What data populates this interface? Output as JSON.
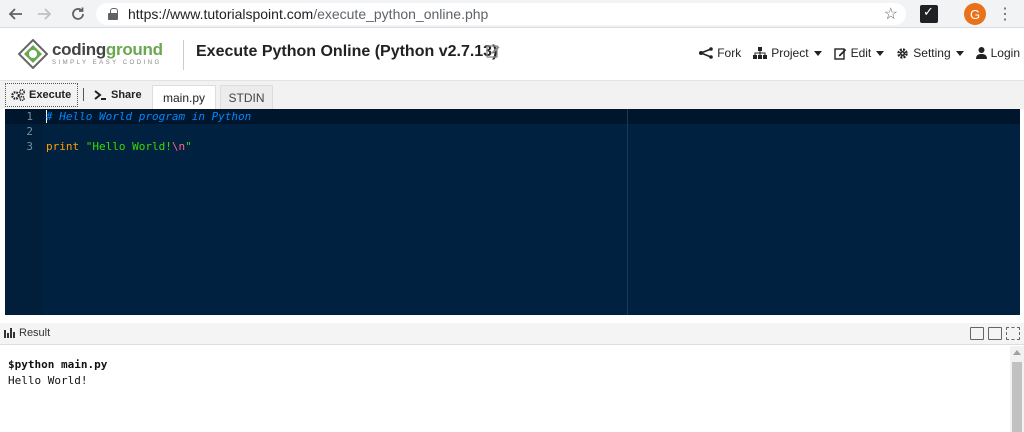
{
  "browser": {
    "url_host": "https://www.tutorialspoint.com",
    "url_path": "/execute_python_online.php",
    "avatar_letter": "G"
  },
  "header": {
    "logo_name_1": "coding",
    "logo_name_2": "ground",
    "logo_tagline": "SIMPLY EASY CODING",
    "title": "Execute Python Online (Python v2.7.13)",
    "menu": {
      "fork": "Fork",
      "project": "Project",
      "edit": "Edit",
      "setting": "Setting",
      "login": "Login"
    }
  },
  "toolbar": {
    "execute": "Execute",
    "share": "Share",
    "tabs": [
      "main.py",
      "STDIN"
    ]
  },
  "editor": {
    "line_numbers": [
      "1",
      "2",
      "3"
    ],
    "comment": "# Hello World program in Python",
    "keyword": "print",
    "string_open": "\"Hello World!",
    "escape": "\\n",
    "string_close": "\""
  },
  "result": {
    "label": "Result",
    "command": "$python main.py",
    "output": "Hello World!"
  },
  "colors": {
    "editor_bg": "#002240",
    "comment": "#0088ff",
    "keyword": "#ff9d00",
    "string": "#3ad900",
    "escape": "#ff628c"
  }
}
